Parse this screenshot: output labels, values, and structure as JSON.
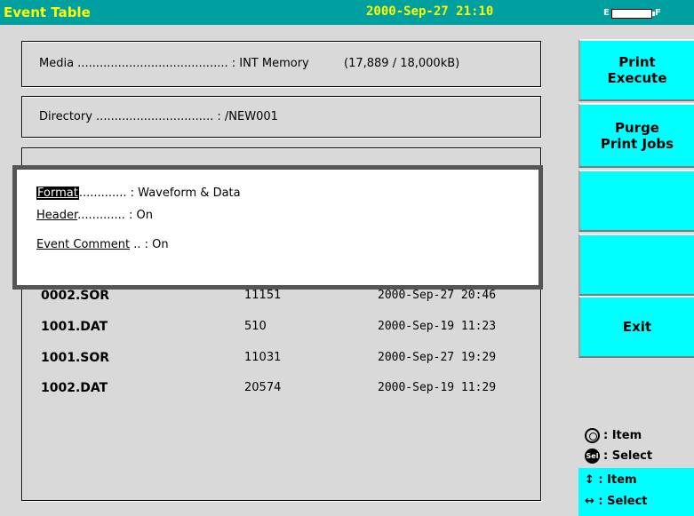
{
  "titlebar": {
    "title": "Event Table",
    "datetime": "2000-Sep-27 21:10",
    "battery_empty_label": "E",
    "battery_full_label": "F"
  },
  "media": {
    "label": "Media ......................................... : INT Memory",
    "usage": "(17,889 / 18,000kB)"
  },
  "directory": {
    "label": "Directory ................................ : /NEW001"
  },
  "popup": {
    "rows": [
      {
        "key": "Format",
        "rest": "............. : Waveform & Data"
      },
      {
        "key": "Header",
        "rest": "............. : On"
      },
      {
        "key": "Event Comment",
        "rest": " .. : On"
      }
    ]
  },
  "files": [
    {
      "name": "0002.SOR",
      "size": "11151",
      "date": "2000-Sep-27 20:46"
    },
    {
      "name": "1001.DAT",
      "size": "510",
      "date": "2000-Sep-19 11:23"
    },
    {
      "name": "1001.SOR",
      "size": "11031",
      "date": "2000-Sep-27 19:29"
    },
    {
      "name": "1002.DAT",
      "size": "20574",
      "date": "2000-Sep-19 11:29"
    }
  ],
  "softkeys": {
    "print_execute": "Print\nExecute",
    "purge_print_jobs": "Purge\nPrint Jobs",
    "blank1": "",
    "blank2": "",
    "exit": "Exit"
  },
  "legend": {
    "knob_text": ": Item",
    "sel_icon_text": "Sel",
    "sel_text": ": Select",
    "updown_text": "↕ : Item",
    "leftright_text": "↔ : Select"
  },
  "colors": {
    "titlebar": "#00a0a0",
    "title_text": "#ffff00",
    "softkey": "#00ffff",
    "background": "#d9d9d9"
  }
}
